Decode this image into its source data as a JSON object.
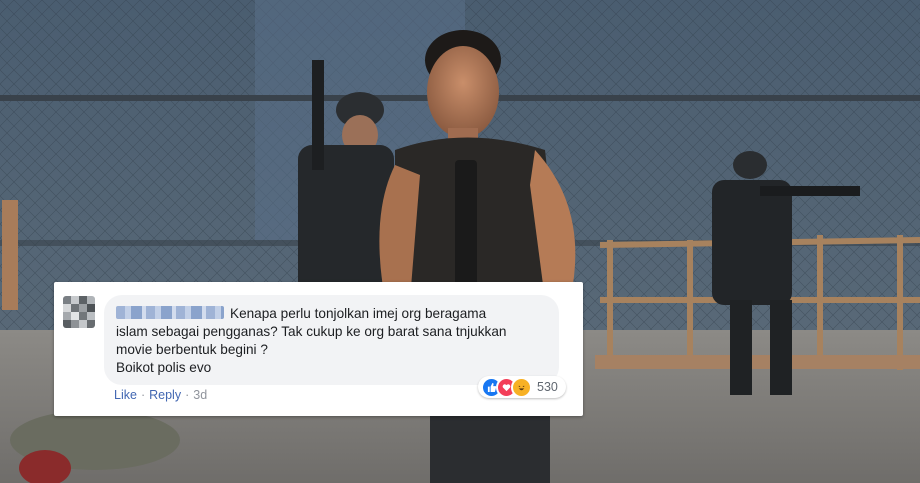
{
  "comment": {
    "commenter_name_blurred": "",
    "text_line1": "Kenapa perlu tonjolkan imej org beragama",
    "text_line2": "islam sebagai pengganas? Tak cukup ke org barat sana tnjukkan",
    "text_line3": "movie berbentuk begini ?",
    "text_line4": "Boikot polis evo",
    "reaction_count": "530",
    "reactions": [
      "like-icon",
      "love-icon",
      "haha-icon"
    ],
    "like_label": "Like",
    "separator": "·",
    "reply_label": "Reply",
    "timestamp": "3d"
  },
  "colors": {
    "facebook_blue": "#4267b2",
    "like_blue": "#1877f2",
    "love_red": "#f33e58",
    "haha_yellow": "#f7b125",
    "bubble_bg": "#f2f3f5"
  }
}
